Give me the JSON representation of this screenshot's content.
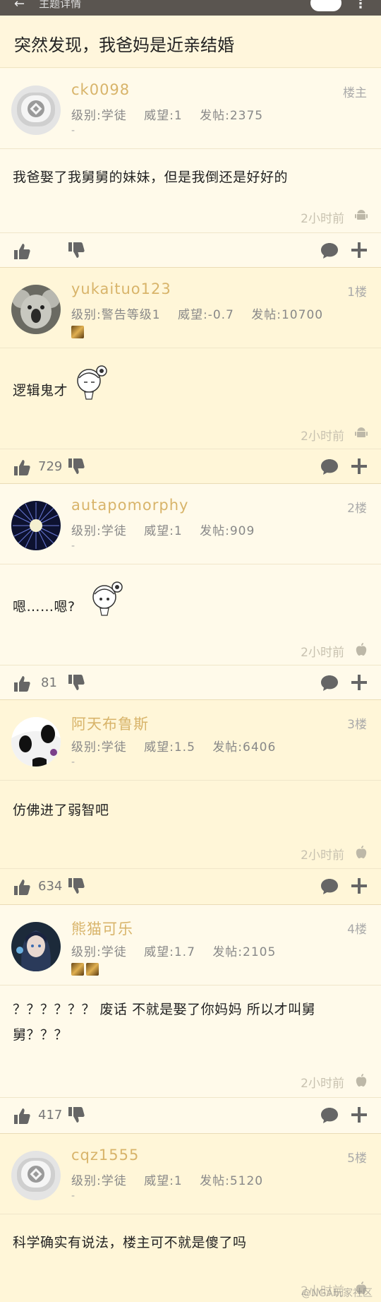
{
  "topbar": {
    "back": "←",
    "title": "主题详情",
    "more": "⋮"
  },
  "thread": {
    "title": "突然发现，我爸妈是近亲结婚"
  },
  "posts": [
    {
      "username": "ck0098",
      "level": "级别:学徒",
      "prestige": "威望:1",
      "count": "发帖:2375",
      "dash": "-",
      "floor": "楼主",
      "content": "我爸娶了我舅舅的妹妹，但是我倒还是好好的",
      "time": "2小时前",
      "os": "android-icon",
      "likes": ""
    },
    {
      "username": "yukaituo123",
      "level": "级别:警告等级1",
      "prestige": "威望:-0.7",
      "count": "发帖:10700",
      "floor": "1楼",
      "content": "逻辑鬼才",
      "time": "2小时前",
      "os": "android-icon",
      "likes": "729"
    },
    {
      "username": "autapomorphy",
      "level": "级别:学徒",
      "prestige": "威望:1",
      "count": "发帖:909",
      "dash": "-",
      "floor": "2楼",
      "content": "嗯……嗯?",
      "time": "2小时前",
      "os": "apple-icon",
      "likes": "81"
    },
    {
      "username": "阿天布鲁斯",
      "level": "级别:学徒",
      "prestige": "威望:1.5",
      "count": "发帖:6406",
      "dash": "-",
      "floor": "3楼",
      "content": "仿佛进了弱智吧",
      "time": "2小时前",
      "os": "apple-icon",
      "likes": "634"
    },
    {
      "username": "熊猫可乐",
      "level": "级别:学徒",
      "prestige": "威望:1.7",
      "count": "发帖:2105",
      "floor": "4楼",
      "content": "？？？？？？ 废话 不就是娶了你妈妈 所以才叫舅舅？？？",
      "time": "2小时前",
      "os": "apple-icon",
      "likes": "417"
    },
    {
      "username": "cqz1555",
      "level": "级别:学徒",
      "prestige": "威望:1",
      "count": "发帖:5120",
      "dash": "-",
      "floor": "5楼",
      "content": "科学确实有说法，楼主可不就是傻了吗",
      "time": "2小时前",
      "os": "apple-icon",
      "likes": ""
    }
  ],
  "watermark": "@NGA玩家社区",
  "colors": {
    "username": "#d8b46a",
    "background": "#fff8e0",
    "icon": "#666666"
  }
}
